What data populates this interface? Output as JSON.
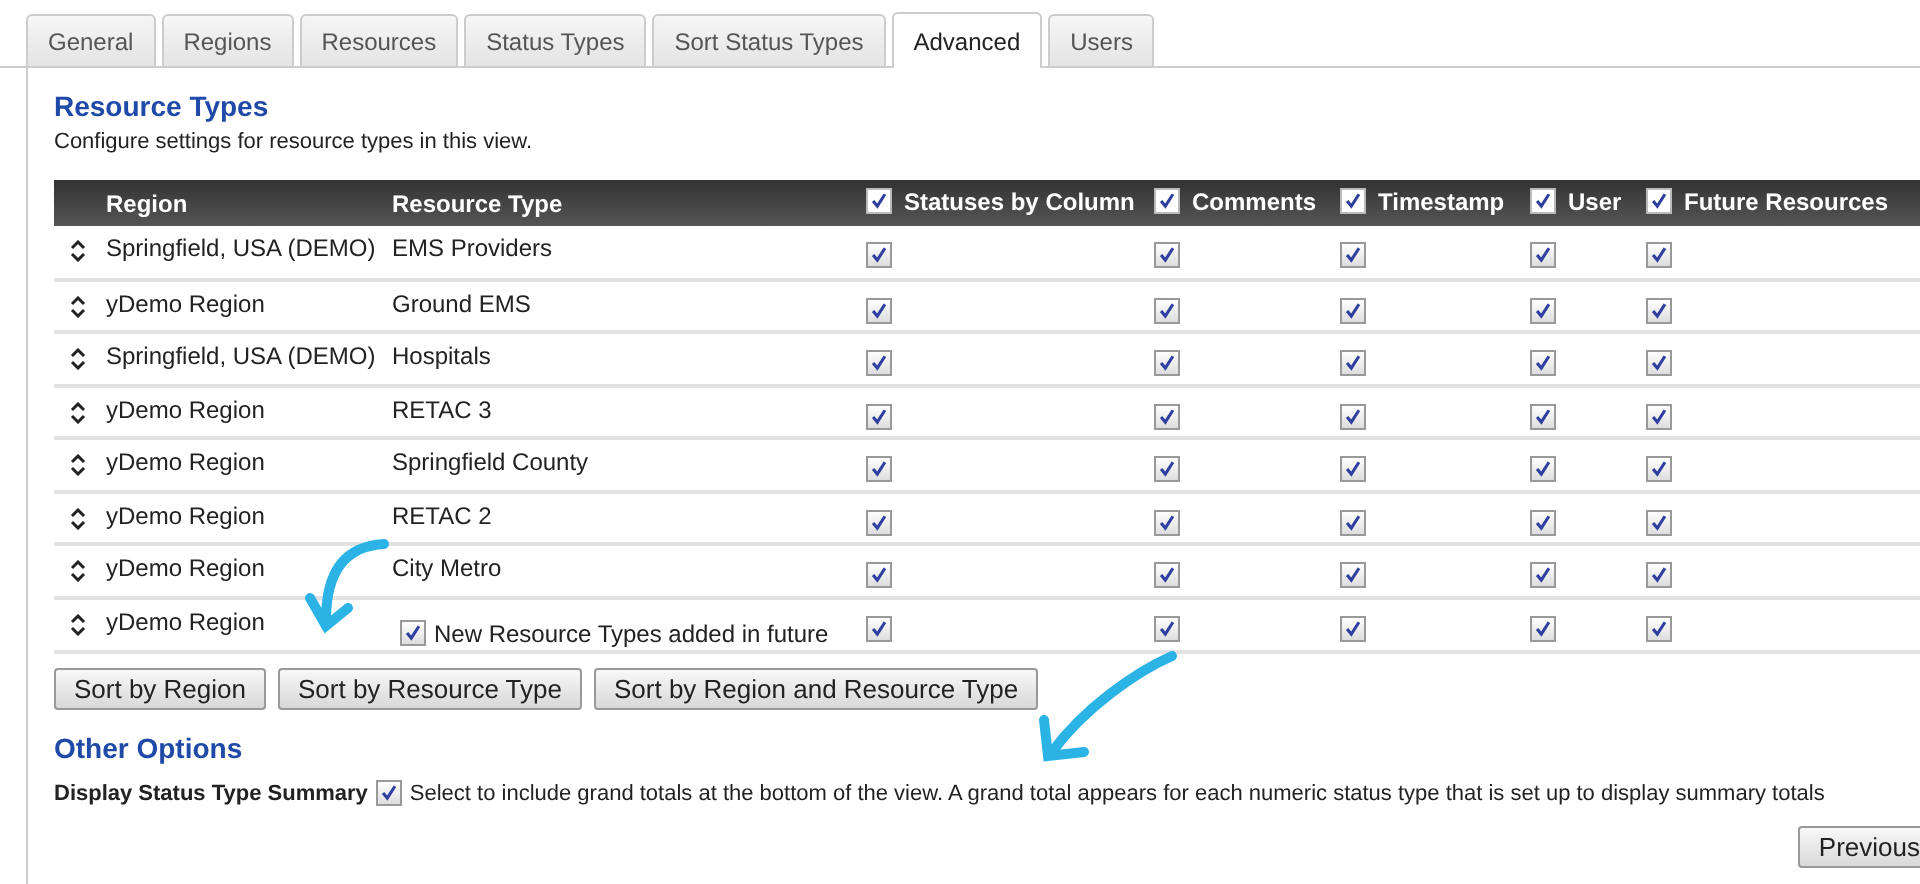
{
  "tabs": [
    {
      "label": "General",
      "selected": false
    },
    {
      "label": "Regions",
      "selected": false
    },
    {
      "label": "Resources",
      "selected": false
    },
    {
      "label": "Status Types",
      "selected": false
    },
    {
      "label": "Sort Status Types",
      "selected": false
    },
    {
      "label": "Advanced",
      "selected": true
    },
    {
      "label": "Users",
      "selected": false
    }
  ],
  "resource_types": {
    "title": "Resource Types",
    "description": "Configure settings for resource types in this view.",
    "columns": [
      {
        "label": "Region"
      },
      {
        "label": "Resource Type"
      },
      {
        "label": "Statuses by Column",
        "checked": true
      },
      {
        "label": "Comments",
        "checked": true
      },
      {
        "label": "Timestamp",
        "checked": true
      },
      {
        "label": "User",
        "checked": true
      },
      {
        "label": "Future Resources",
        "checked": true
      }
    ],
    "rows": [
      {
        "region": "Springfield, USA (DEMO)",
        "resource_type": "EMS Providers",
        "checks": [
          true,
          true,
          true,
          true,
          true
        ]
      },
      {
        "region": "yDemo Region",
        "resource_type": "Ground EMS",
        "checks": [
          true,
          true,
          true,
          true,
          true
        ]
      },
      {
        "region": "Springfield, USA (DEMO)",
        "resource_type": "Hospitals",
        "checks": [
          true,
          true,
          true,
          true,
          true
        ]
      },
      {
        "region": "yDemo Region",
        "resource_type": "RETAC 3",
        "checks": [
          true,
          true,
          true,
          true,
          true
        ]
      },
      {
        "region": "yDemo Region",
        "resource_type": "Springfield County",
        "checks": [
          true,
          true,
          true,
          true,
          true
        ]
      },
      {
        "region": "yDemo Region",
        "resource_type": "RETAC 2",
        "checks": [
          true,
          true,
          true,
          true,
          true
        ]
      },
      {
        "region": "yDemo Region",
        "resource_type": "City Metro",
        "checks": [
          true,
          true,
          true,
          true,
          true
        ]
      },
      {
        "region": "yDemo Region",
        "resource_type": "New Resource Types added in future",
        "kind": "future",
        "future_checked": true,
        "checks": [
          true,
          true,
          true,
          true,
          true
        ]
      }
    ],
    "buttons": [
      "Sort by Region",
      "Sort by Resource Type",
      "Sort by Region and Resource Type"
    ]
  },
  "other_options": {
    "title": "Other Options",
    "label": "Display Status Type Summary",
    "checked": true,
    "description": "Select to include grand totals at the bottom of the view. A grand total appears for each numeric status type that is set up to display summary totals"
  },
  "footer_buttons": [
    "Previous"
  ]
}
